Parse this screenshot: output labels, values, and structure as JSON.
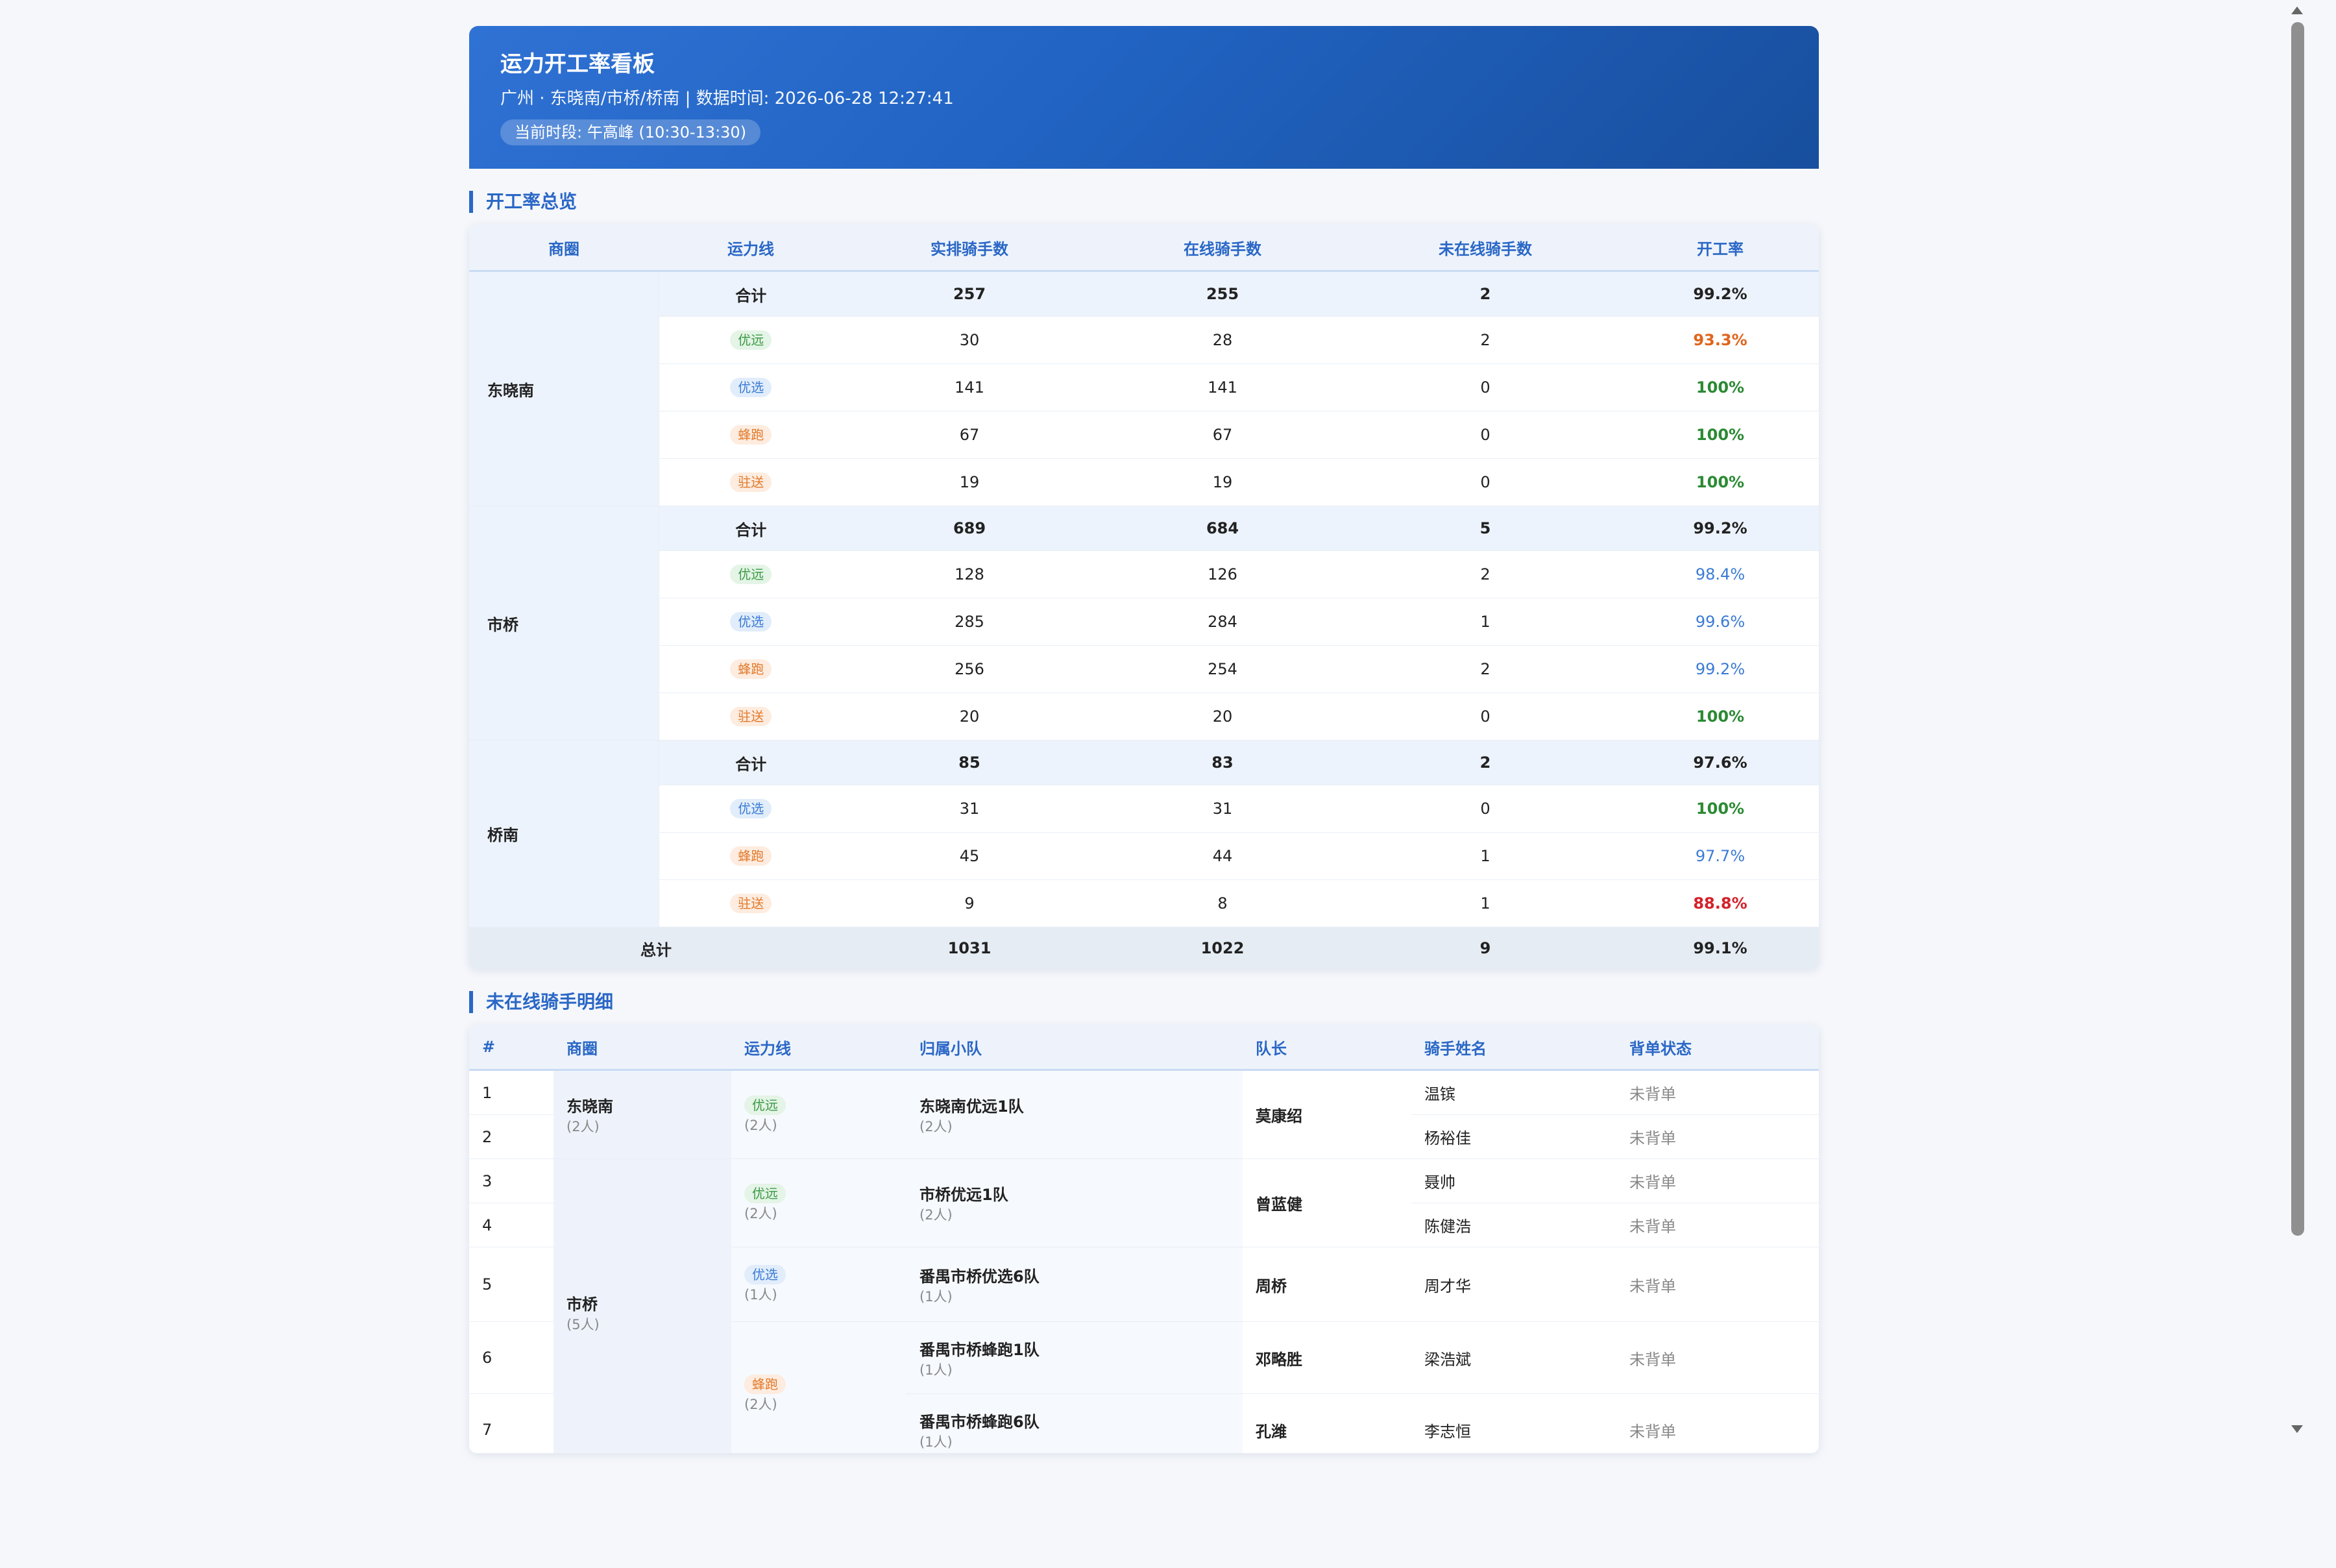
{
  "header": {
    "title": "运力开工率看板",
    "subtitle": "广州 · 东晓南/市桥/桥南 | 数据时间: 2026-06-28 12:27:41",
    "period": "当前时段: 午高峰 (10:30-13:30)"
  },
  "overview": {
    "section_title": "开工率总览",
    "columns": [
      "商圈",
      "运力线",
      "实排骑手数",
      "在线骑手数",
      "未在线骑手数",
      "开工率"
    ],
    "areas": [
      {
        "name": "东晓南",
        "rows": [
          {
            "line": "合计",
            "scheduled": "257",
            "online": "255",
            "offline": "2",
            "rate": "99.2%",
            "rate_color": "black",
            "summary": true
          },
          {
            "line": "优远",
            "tag_color": "green",
            "scheduled": "30",
            "online": "28",
            "offline": "2",
            "rate": "93.3%",
            "rate_color": "orange"
          },
          {
            "line": "优选",
            "tag_color": "blue",
            "scheduled": "141",
            "online": "141",
            "offline": "0",
            "rate": "100%",
            "rate_color": "green"
          },
          {
            "line": "蜂跑",
            "tag_color": "orange",
            "scheduled": "67",
            "online": "67",
            "offline": "0",
            "rate": "100%",
            "rate_color": "green"
          },
          {
            "line": "驻送",
            "tag_color": "orange",
            "scheduled": "19",
            "online": "19",
            "offline": "0",
            "rate": "100%",
            "rate_color": "green"
          }
        ]
      },
      {
        "name": "市桥",
        "rows": [
          {
            "line": "合计",
            "scheduled": "689",
            "online": "684",
            "offline": "5",
            "rate": "99.2%",
            "rate_color": "black",
            "summary": true
          },
          {
            "line": "优远",
            "tag_color": "green",
            "scheduled": "128",
            "online": "126",
            "offline": "2",
            "rate": "98.4%",
            "rate_color": "blue"
          },
          {
            "line": "优选",
            "tag_color": "blue",
            "scheduled": "285",
            "online": "284",
            "offline": "1",
            "rate": "99.6%",
            "rate_color": "blue"
          },
          {
            "line": "蜂跑",
            "tag_color": "orange",
            "scheduled": "256",
            "online": "254",
            "offline": "2",
            "rate": "99.2%",
            "rate_color": "blue"
          },
          {
            "line": "驻送",
            "tag_color": "orange",
            "scheduled": "20",
            "online": "20",
            "offline": "0",
            "rate": "100%",
            "rate_color": "green"
          }
        ]
      },
      {
        "name": "桥南",
        "rows": [
          {
            "line": "合计",
            "scheduled": "85",
            "online": "83",
            "offline": "2",
            "rate": "97.6%",
            "rate_color": "black",
            "summary": true
          },
          {
            "line": "优选",
            "tag_color": "blue",
            "scheduled": "31",
            "online": "31",
            "offline": "0",
            "rate": "100%",
            "rate_color": "green"
          },
          {
            "line": "蜂跑",
            "tag_color": "orange",
            "scheduled": "45",
            "online": "44",
            "offline": "1",
            "rate": "97.7%",
            "rate_color": "blue"
          },
          {
            "line": "驻送",
            "tag_color": "orange",
            "scheduled": "9",
            "online": "8",
            "offline": "1",
            "rate": "88.8%",
            "rate_color": "red"
          }
        ]
      }
    ],
    "total": {
      "label": "总计",
      "scheduled": "1031",
      "online": "1022",
      "offline": "9",
      "rate": "99.1%"
    }
  },
  "offline_detail": {
    "section_title": "未在线骑手明细",
    "columns": [
      "#",
      "商圈",
      "运力线",
      "归属小队",
      "队长",
      "骑手姓名",
      "背单状态"
    ],
    "areas": [
      {
        "name": "东晓南",
        "count": "(2人)",
        "lines": [
          {
            "line": "优远",
            "tag_color": "green",
            "count": "(2人)",
            "teams": [
              {
                "team": "东晓南优远1队",
                "count": "(2人)",
                "captain": "莫康绍",
                "riders": [
                  {
                    "no": "1",
                    "name": "温镔",
                    "status": "未背单"
                  },
                  {
                    "no": "2",
                    "name": "杨裕佳",
                    "status": "未背单"
                  }
                ]
              }
            ]
          }
        ]
      },
      {
        "name": "市桥",
        "count": "(5人)",
        "lines": [
          {
            "line": "优远",
            "tag_color": "green",
            "count": "(2人)",
            "teams": [
              {
                "team": "市桥优远1队",
                "count": "(2人)",
                "captain": "曾蓝健",
                "riders": [
                  {
                    "no": "3",
                    "name": "聂帅",
                    "status": "未背单"
                  },
                  {
                    "no": "4",
                    "name": "陈健浩",
                    "status": "未背单"
                  }
                ]
              }
            ]
          },
          {
            "line": "优选",
            "tag_color": "blue",
            "count": "(1人)",
            "teams": [
              {
                "team": "番禺市桥优选6队",
                "count": "(1人)",
                "captain": "周桥",
                "riders": [
                  {
                    "no": "5",
                    "name": "周才华",
                    "status": "未背单"
                  }
                ]
              }
            ]
          },
          {
            "line": "蜂跑",
            "tag_color": "orange",
            "count": "(2人)",
            "teams": [
              {
                "team": "番禺市桥蜂跑1队",
                "count": "(1人)",
                "captain": "邓略胜",
                "riders": [
                  {
                    "no": "6",
                    "name": "梁浩斌",
                    "status": "未背单"
                  }
                ]
              },
              {
                "team": "番禺市桥蜂跑6队",
                "count": "(1人)",
                "captain": "孔潍",
                "riders": [
                  {
                    "no": "7",
                    "name": "李志恒",
                    "status": "未背单"
                  }
                ]
              }
            ]
          }
        ]
      }
    ]
  }
}
